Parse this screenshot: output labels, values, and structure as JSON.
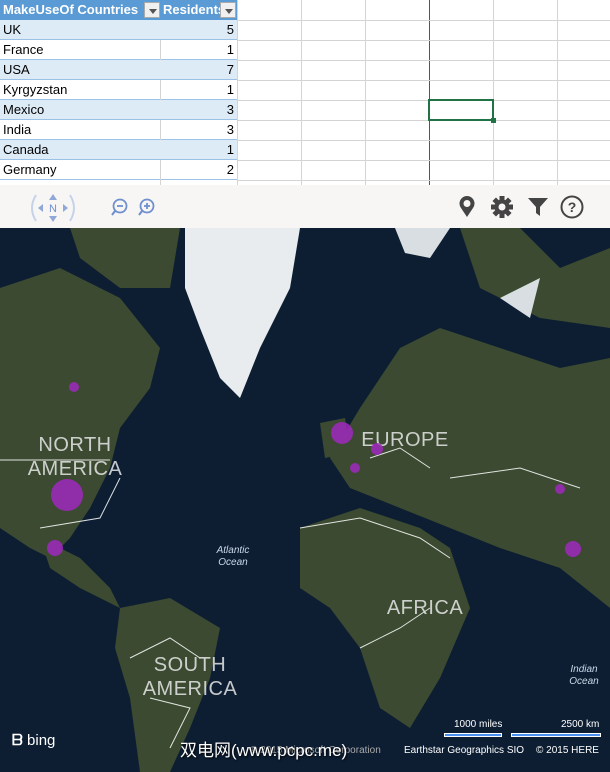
{
  "table": {
    "headers": [
      "MakeUseOf Countries",
      "Residents"
    ],
    "rows": [
      [
        "UK",
        "5"
      ],
      [
        "France",
        "1"
      ],
      [
        "USA",
        "7"
      ],
      [
        "Kyrgyzstan",
        "1"
      ],
      [
        "Mexico",
        "3"
      ],
      [
        "India",
        "3"
      ],
      [
        "Canada",
        "1"
      ],
      [
        "Germany",
        "2"
      ]
    ]
  },
  "toolbar": {
    "compass_label": "N",
    "icons": [
      "pan-compass",
      "zoom-out",
      "zoom-in",
      "location-pin",
      "settings-gear",
      "filter-funnel",
      "help-question"
    ]
  },
  "map": {
    "labels": {
      "north_america": [
        "NORTH",
        "AMERICA"
      ],
      "europe": "EUROPE",
      "africa": "AFRICA",
      "south_america": [
        "SOUTH",
        "AMERICA"
      ],
      "atlantic": [
        "Atlantic",
        "Ocean"
      ],
      "indian": [
        "Indian",
        "Ocean"
      ]
    },
    "bubble_color": "#a028be",
    "scale": {
      "miles": "1000 miles",
      "km": "2500 km"
    },
    "brand": "bing",
    "attribution": {
      "microsoft": "© 2015 Microsoft Corporation",
      "earthstar": "Earthstar Geographics SIO",
      "here": "© 2015 HERE"
    },
    "watermark": "双电网(www.pcpc.me)"
  }
}
